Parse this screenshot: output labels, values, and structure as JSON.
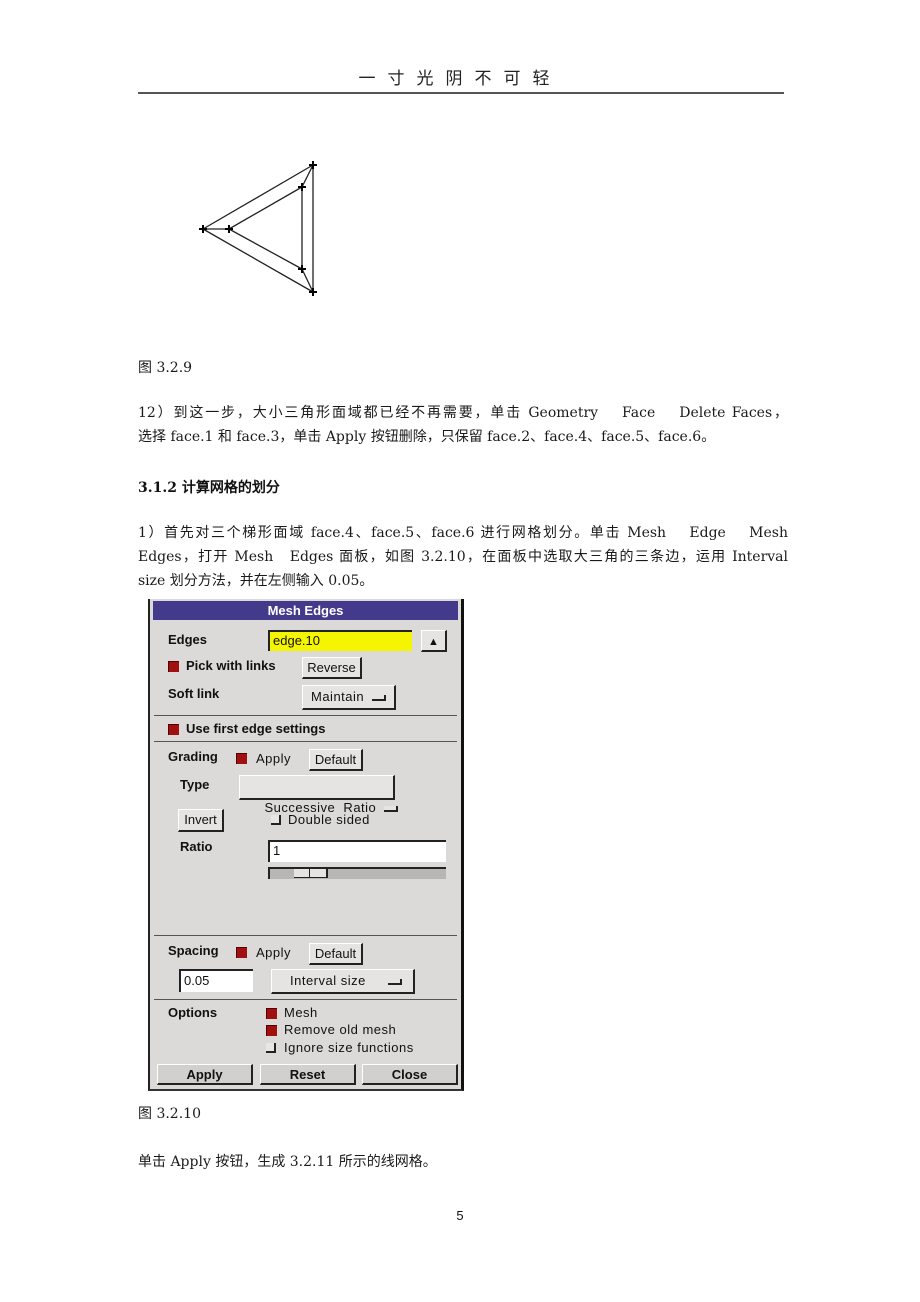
{
  "header": {
    "title": "一寸光阴不可轻"
  },
  "figure_329": {
    "caption": "图 3.2.9",
    "icon": "triangle-geometry-sketch"
  },
  "paragraph_12": {
    "line1": "12）到这一步，大小三角形面域都已经不再需要，单击 Geometry　 Face　 Delete Faces，",
    "line2": "选择 face.1 和 face.3，单击 Apply 按钮删除，只保留 face.2、face.4、face.5、face.6。"
  },
  "section": {
    "heading": "3.1.2 计算网格的划分"
  },
  "paragraph_1": {
    "line1": "1）首先对三个梯形面域 face.4、face.5、face.6 进行网格划分。单击 Mesh　 Edge　 Mesh",
    "line2": "Edges，打开 Mesh　Edges 面板，如图 3.2.10，在面板中选取大三角的三条边，运用 Interval",
    "line3": "size 划分方法，并在左侧输入 0.05。"
  },
  "dialog": {
    "title": "Mesh Edges",
    "edges_label": "Edges",
    "edges_value": "edge.10",
    "up_arrow_icon": "up-arrow-icon",
    "pick_with_links": {
      "label": "Pick with links",
      "checked": true
    },
    "reverse_label": "Reverse",
    "soft_link_label": "Soft link",
    "soft_link_value": "Maintain",
    "use_first_edge": {
      "label": "Use first edge settings",
      "checked": true
    },
    "grading": {
      "label": "Grading",
      "apply_label": "Apply",
      "apply_checked": true,
      "default_label": "Default",
      "type_label": "Type",
      "type_value": "Successive  Ratio",
      "invert_label": "Invert",
      "double_sided": {
        "label": "Double sided",
        "checked": false
      },
      "ratio_label": "Ratio",
      "ratio_value": "1"
    },
    "spacing": {
      "label": "Spacing",
      "apply_label": "Apply",
      "apply_checked": true,
      "default_label": "Default",
      "value": "0.05",
      "method": "Interval size"
    },
    "options": {
      "label": "Options",
      "mesh": {
        "label": "Mesh",
        "checked": true
      },
      "remove_old_mesh": {
        "label": "Remove old mesh",
        "checked": true
      },
      "ignore_size_functions": {
        "label": "Ignore size functions",
        "checked": false
      }
    },
    "buttons": {
      "apply": "Apply",
      "reset": "Reset",
      "close": "Close"
    }
  },
  "figure_3210": {
    "caption": "图 3.2.10"
  },
  "paragraph_after": {
    "text": "单击 Apply 按钮，生成 3.2.11 所示的线网格。"
  },
  "page_number": "5"
}
